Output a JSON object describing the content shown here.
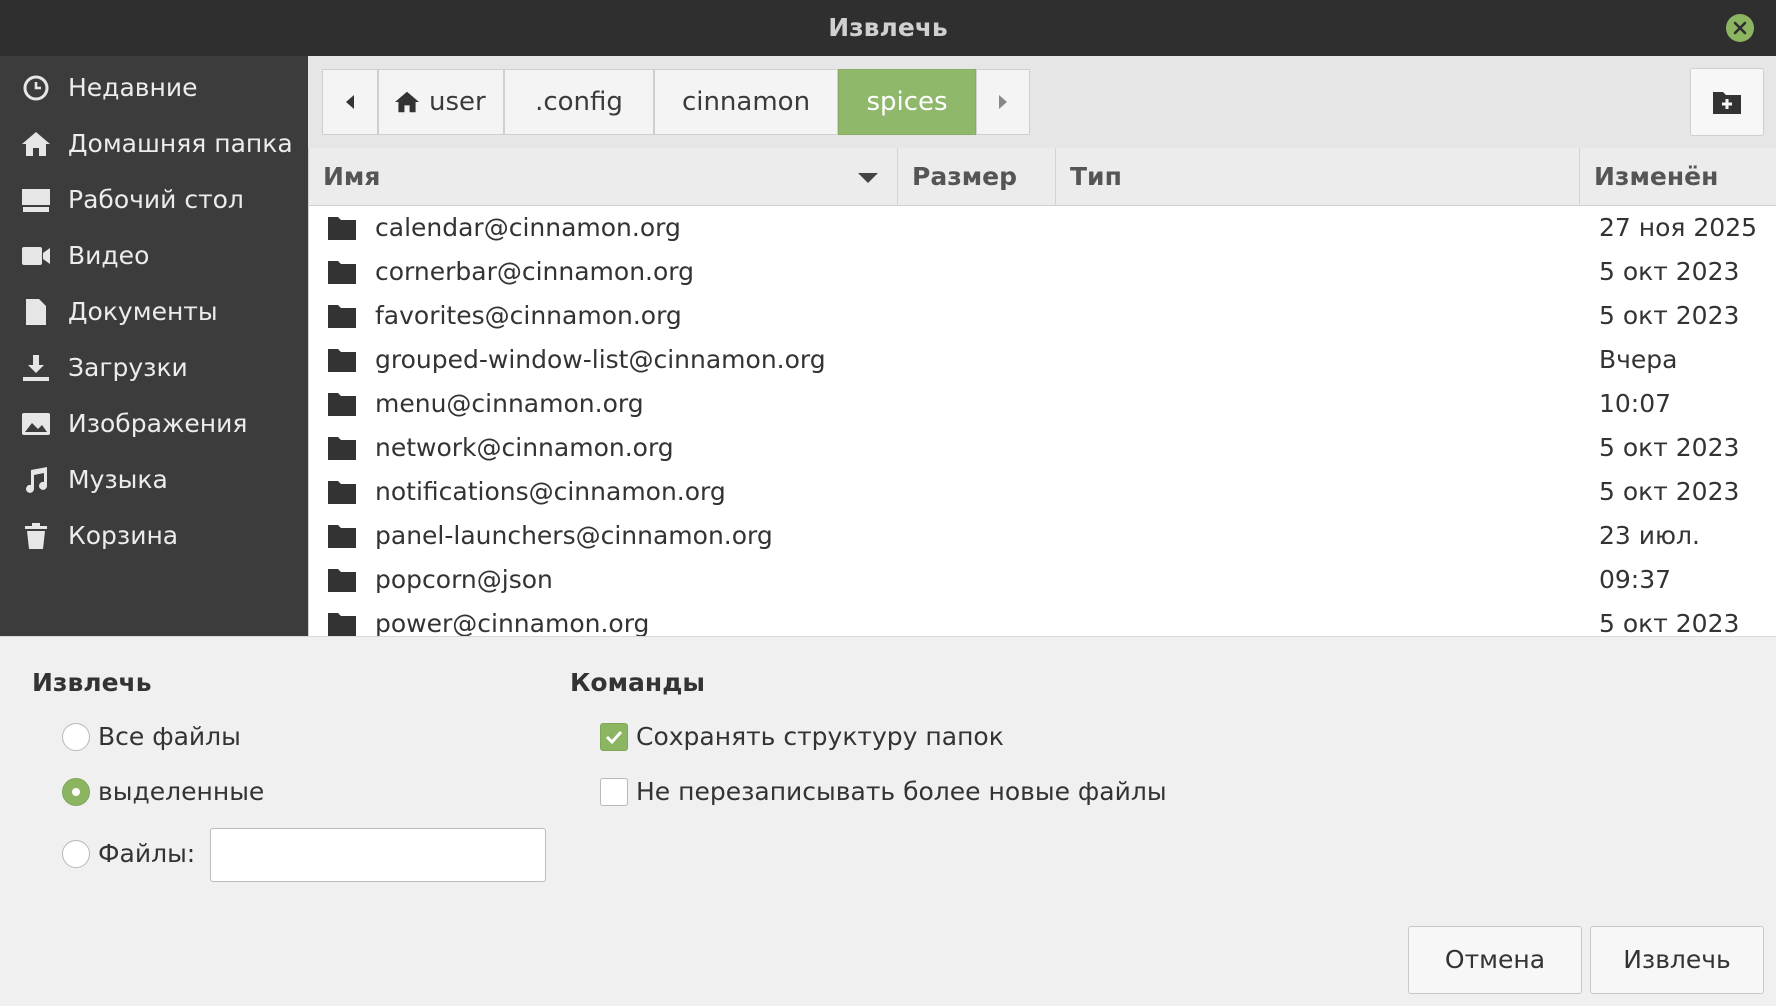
{
  "window": {
    "title": "Извлечь",
    "close_icon": "close-icon"
  },
  "sidebar": {
    "items": [
      {
        "label": "Недавние",
        "icon": "clock-icon"
      },
      {
        "label": "Домашняя папка",
        "icon": "home-icon"
      },
      {
        "label": "Рабочий стол",
        "icon": "desktop-icon"
      },
      {
        "label": "Видео",
        "icon": "video-icon"
      },
      {
        "label": "Документы",
        "icon": "document-icon"
      },
      {
        "label": "Загрузки",
        "icon": "download-icon"
      },
      {
        "label": "Изображения",
        "icon": "image-icon"
      },
      {
        "label": "Музыка",
        "icon": "music-icon"
      },
      {
        "label": "Корзина",
        "icon": "trash-icon"
      }
    ]
  },
  "pathbar": {
    "segments": [
      "user",
      ".config",
      "cinnamon",
      "spices"
    ],
    "active_segment": "spices",
    "accent_color": "#8fb86a"
  },
  "filelist": {
    "columns": {
      "name": "Имя",
      "size": "Размер",
      "type": "Тип",
      "modified": "Изменён"
    },
    "rows": [
      {
        "name": "calendar@cinnamon.org",
        "modified": "27 ноя 2025"
      },
      {
        "name": "cornerbar@cinnamon.org",
        "modified": "5 окт 2023"
      },
      {
        "name": "favorites@cinnamon.org",
        "modified": "5 окт 2023"
      },
      {
        "name": "grouped-window-list@cinnamon.org",
        "modified": "Вчера"
      },
      {
        "name": "menu@cinnamon.org",
        "modified": "10:07"
      },
      {
        "name": "network@cinnamon.org",
        "modified": "5 окт 2023"
      },
      {
        "name": "notifications@cinnamon.org",
        "modified": "5 окт 2023"
      },
      {
        "name": "panel-launchers@cinnamon.org",
        "modified": "23 июл."
      },
      {
        "name": "popcorn@json",
        "modified": "09:37"
      },
      {
        "name": "power@cinnamon.org",
        "modified": "5 окт 2023"
      }
    ]
  },
  "extract": {
    "title": "Извлечь",
    "all_files": "Все файлы",
    "selected": "выделенные",
    "files_label": "Файлы:",
    "files_value": "",
    "selected_option": "selected"
  },
  "commands": {
    "title": "Команды",
    "keep_structure": "Сохранять структуру папок",
    "keep_structure_checked": true,
    "no_overwrite": "Не перезаписывать более новые файлы",
    "no_overwrite_checked": false
  },
  "buttons": {
    "cancel": "Отмена",
    "extract": "Извлечь"
  }
}
